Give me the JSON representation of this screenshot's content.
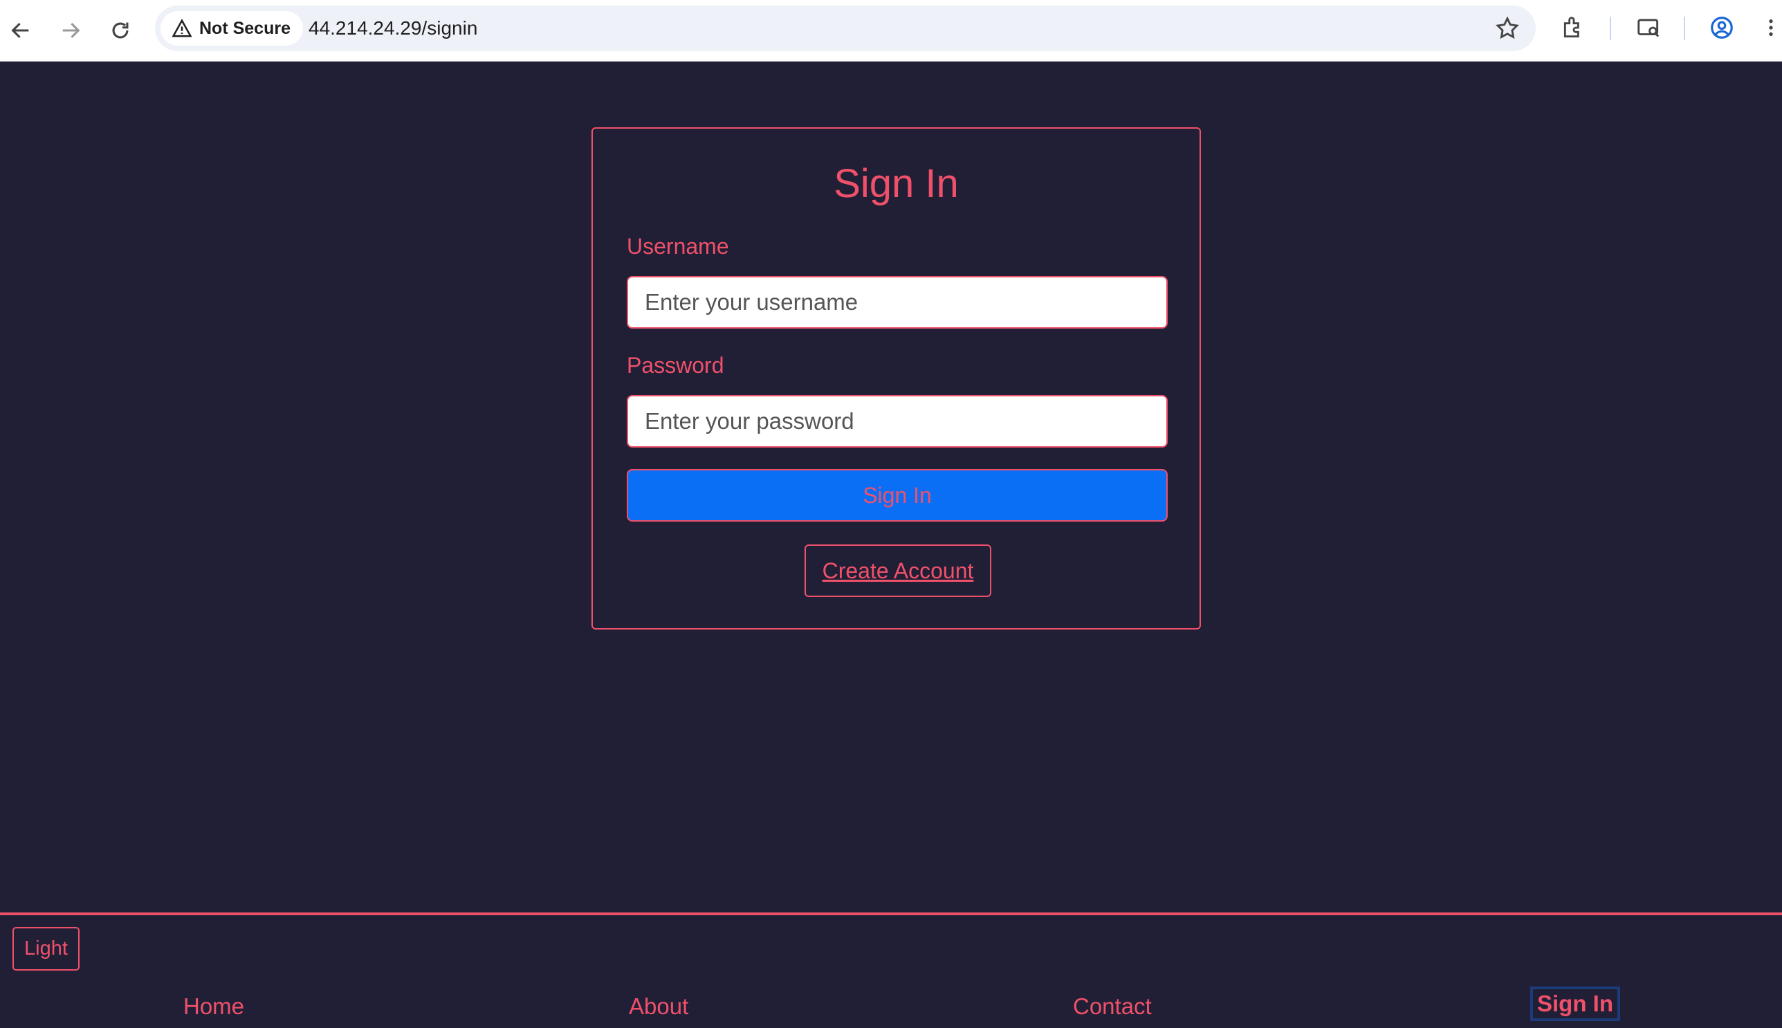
{
  "browser": {
    "security_label": "Not Secure",
    "url": "44.214.24.29/signin",
    "icons": [
      "back-arrow-icon",
      "forward-arrow-icon",
      "reload-icon",
      "warning-icon",
      "bookmark-star-icon",
      "extensions-icon",
      "tab-search-icon",
      "profile-icon",
      "menu-dots-icon"
    ]
  },
  "signin": {
    "title": "Sign In",
    "username_label": "Username",
    "username_placeholder": "Enter your username",
    "password_label": "Password",
    "password_placeholder": "Enter your password",
    "submit_label": "Sign In",
    "create_account_label": "Create Account"
  },
  "footer": {
    "theme_toggle_label": "Light",
    "nav": [
      {
        "label": "Home"
      },
      {
        "label": "About"
      },
      {
        "label": "Contact"
      },
      {
        "label": "Sign In",
        "active": true
      }
    ]
  },
  "colors": {
    "background": "#201f36",
    "accent": "#f0516a",
    "primary_button": "#0a6ff5"
  }
}
